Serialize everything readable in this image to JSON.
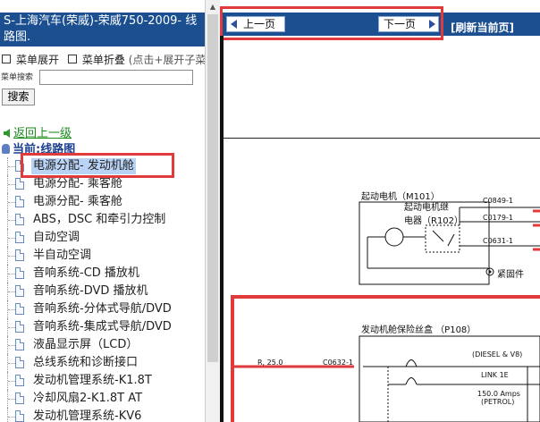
{
  "left_panel": {
    "title": "S-上海汽车(荣威)-荣威750-2009- 线路图.",
    "menu_expand": "菜单展开",
    "menu_collapse": "菜单折叠",
    "menu_hint": "(点击+展开子菜",
    "search_label": "菜单搜索",
    "search_value": "",
    "search_button": "搜索",
    "back_link": "返回上一级",
    "current_label": "当前:线路图",
    "tree_items": [
      "电源分配- 发动机舱",
      "电源分配- 乘客舱",
      "电源分配- 乘客舱",
      "ABS，DSC 和牵引力控制",
      "自动空调",
      "半自动空调",
      "音响系统-CD 播放机",
      "音响系统-DVD 播放机",
      "音响系统-分体式导航/DVD",
      "音响系统-集成式导航/DVD",
      "液晶显示屏（LCD）",
      "总线系统和诊断接口",
      "发动机管理系统-K1.8T",
      "冷却风扇2-K1.8T AT",
      "发动机管理系统-KV6"
    ]
  },
  "toolbar": {
    "prev": "上一页",
    "next": "下一页",
    "refresh": "[刷新当前页]"
  },
  "diagram": {
    "starter_title": "起动电机（M101）",
    "relay_label_1": "起动电机继",
    "relay_label_2": "电器（R102）",
    "c0849": "C0849-1",
    "c0179": "C0179-1",
    "c0631": "C0631-1",
    "fastener": "紧固件",
    "fusebox_title": "发动机舱保险丝盒 （P108）",
    "diesel": "(DIESEL & V8)",
    "wire": "R, 25.0",
    "c0632": "C0632-1",
    "link": "LINK 1E",
    "amps": "150.0 Amps",
    "petrol": "(PETROL)"
  },
  "colors": {
    "header_blue": "#1b4f90",
    "highlight_red": "#e03a3a",
    "selected_bg": "#b9d3f5",
    "link_green": "#1a8a1a"
  }
}
